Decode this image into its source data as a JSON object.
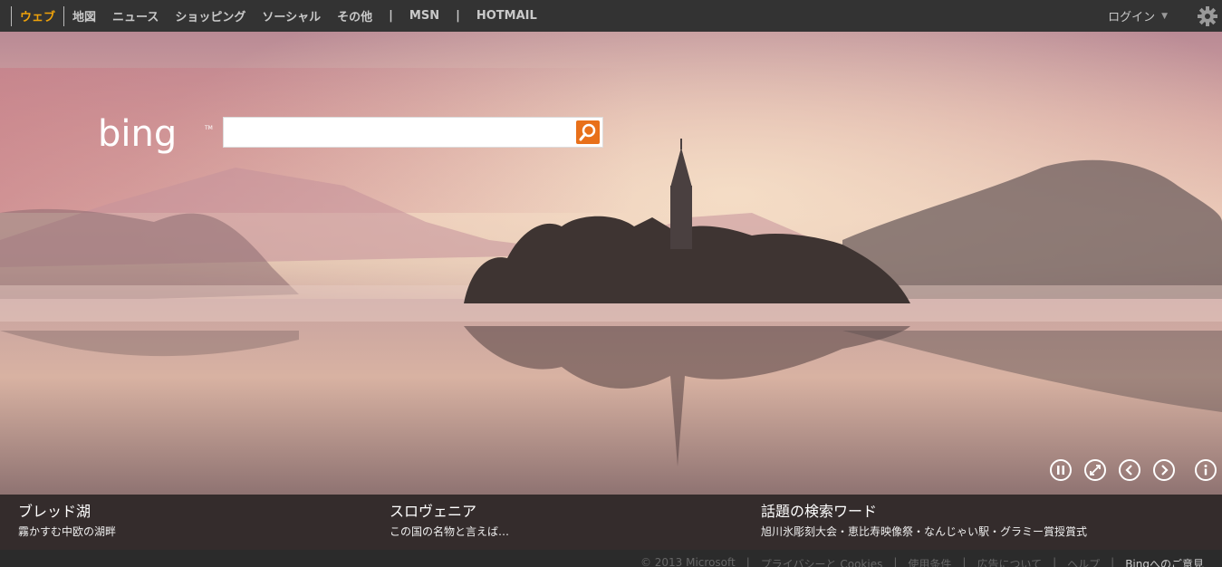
{
  "nav": {
    "items": [
      {
        "label": "ウェブ",
        "active": true
      },
      {
        "label": "地図"
      },
      {
        "label": "ニュース"
      },
      {
        "label": "ショッピング"
      },
      {
        "label": "ソーシャル"
      },
      {
        "label": "その他"
      }
    ],
    "separator": "|",
    "msn": "MSN",
    "hotmail": "HOTMAIL",
    "login": "ログイン",
    "login_caret": "▼"
  },
  "colors": {
    "active_nav": "#f0a30a",
    "search_button": "#e8701a"
  },
  "search": {
    "value": "",
    "placeholder": ""
  },
  "captions": [
    {
      "title": "ブレッド湖",
      "subtitle": "霧かすむ中欧の湖畔"
    },
    {
      "title": "スロヴェニア",
      "subtitle": "この国の名物と言えば…"
    },
    {
      "title": "話題の検索ワード",
      "subtitle": "旭川氷彫刻大会・恵比寿映像祭・なんじゃい駅・グラミー賞授賞式"
    }
  ],
  "footer": {
    "copyright": "© 2013 Microsoft",
    "links": [
      "プライバシーと Cookies",
      "使用条件",
      "広告について",
      "ヘルプ"
    ],
    "feedback": "Bingへのご意見",
    "separator": "|"
  },
  "icons": [
    "settings-gear-icon",
    "search-icon",
    "pause-icon",
    "fullscreen-icon",
    "previous-icon",
    "next-icon",
    "info-icon"
  ]
}
